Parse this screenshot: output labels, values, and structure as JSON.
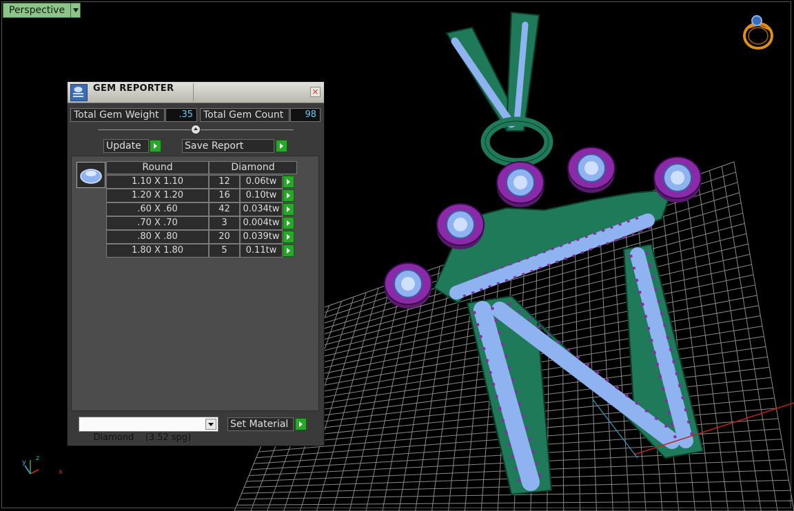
{
  "viewport": {
    "view_name": "Perspective"
  },
  "gem_reporter": {
    "title": "GEM REPORTER",
    "close_symbol": "×",
    "total_gem_weight_label": "Total Gem Weight",
    "total_gem_weight_value": ".35",
    "total_gem_count_label": "Total Gem Count",
    "total_gem_count_value": "98",
    "update_label": "Update",
    "save_report_label": "Save Report",
    "table": {
      "headers": [
        "Round",
        "Diamond"
      ],
      "rows": [
        {
          "size": "1.10 X 1.10",
          "count": "12",
          "weight": "0.06tw"
        },
        {
          "size": "1.20 X 1.20",
          "count": "16",
          "weight": "0.10tw"
        },
        {
          "size": ".60 X .60",
          "count": "42",
          "weight": "0.034tw"
        },
        {
          "size": ".70 X .70",
          "count": "3",
          "weight": "0.004tw"
        },
        {
          "size": ".80 X .80",
          "count": "20",
          "weight": "0.039tw"
        },
        {
          "size": "1.80 X 1.80",
          "count": "5",
          "weight": "0.11tw"
        }
      ]
    },
    "material_select_value": "Diamond    (3.52 spg)",
    "set_material_label": "Set Material"
  },
  "axis": {
    "x": "x",
    "y": "y",
    "z": "z"
  },
  "colors": {
    "metal": "#1f7a5a",
    "gem": "#8fb3f0",
    "prong": "#8a2aa8",
    "grid": "#8a8a8a",
    "view_label_bg": "#8dc48a",
    "go_button": "#28a828"
  },
  "icons": [
    "ring-view-icon",
    "gem-thumbnail-icon",
    "close-icon",
    "play-arrow-icon",
    "dropdown-arrow-icon",
    "slider-knob-icon"
  ]
}
